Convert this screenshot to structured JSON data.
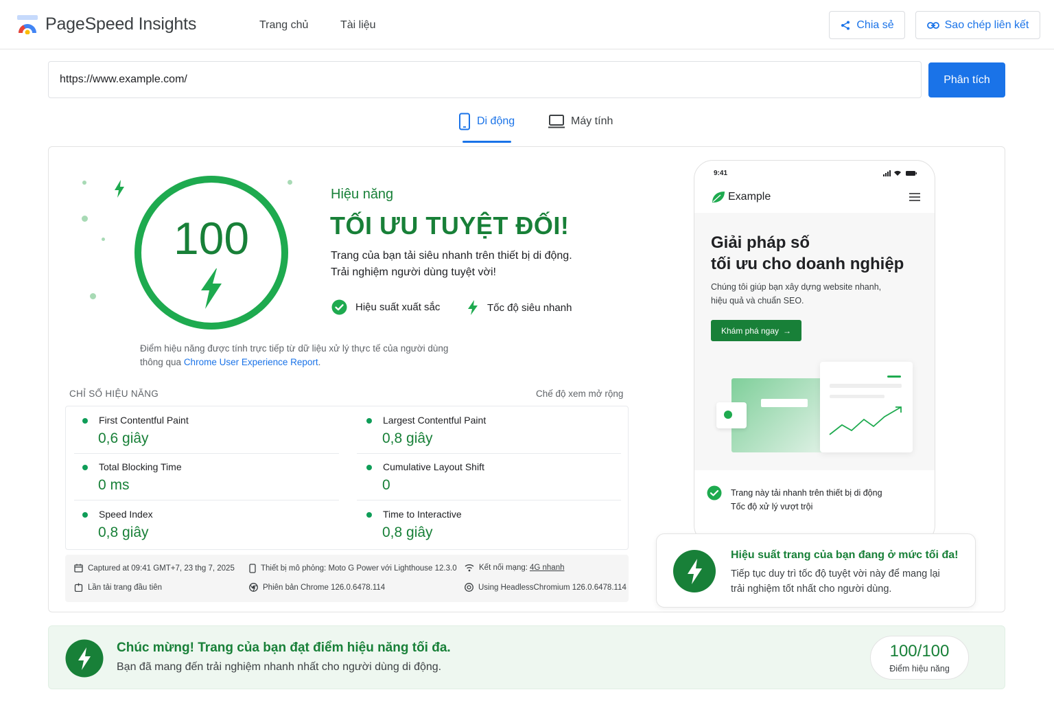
{
  "header": {
    "app_name": "PageSpeed Insights",
    "nav": [
      "Trang chủ",
      "Tài liệu"
    ],
    "share_label": "Chia sẻ",
    "copy_link_label": "Sao chép liên kết"
  },
  "search": {
    "url_value": "https://www.example.com/",
    "analyze_label": "Phân tích"
  },
  "tabs": [
    {
      "label": "Di động",
      "active": true
    },
    {
      "label": "Máy tính",
      "active": false
    }
  ],
  "score": {
    "value": "100",
    "color": "#1eaa4f"
  },
  "performance": {
    "category": "Hiệu năng",
    "headline": "TỐI ƯU TUYỆT ĐỐI!",
    "desc_line1": "Trang của bạn tải siêu nhanh trên thiết bị di động.",
    "desc_line2": "Trải nghiệm người dùng tuyệt vời!",
    "feature1": "Hiệu suất xuất sắc",
    "feature2": "Tốc độ siêu nhanh",
    "note_prefix": "Điểm hiệu năng được tính trực tiếp từ dữ liệu xử lý thực tế của người dùng thông qua ",
    "note_link": "Chrome User Experience Report",
    "note_suffix": "."
  },
  "metrics": {
    "header": "CHỈ SỐ HIỆU NĂNG",
    "expand_label": "Chế độ xem mở rộng",
    "items": [
      {
        "name": "First Contentful Paint",
        "value": "0,6 giây"
      },
      {
        "name": "Largest Contentful Paint",
        "value": "0,8 giây"
      },
      {
        "name": "Total Blocking Time",
        "value": "0 ms"
      },
      {
        "name": "Cumulative Layout Shift",
        "value": "0"
      },
      {
        "name": "Speed Index",
        "value": "0,8 giây"
      },
      {
        "name": "Time to Interactive",
        "value": "0,8 giây"
      }
    ]
  },
  "run_info": {
    "captured": "Captured at 09:41 GMT+7, 23 thg 7, 2025",
    "device": "Thiết bị mô phỏng: Moto G Power với Lighthouse 12.3.0",
    "network_prefix": "Kết nối mạng: ",
    "network_value": "4G nhanh",
    "first_load": "Lần tải trang đầu tiên",
    "chrome_version": "Phiên bản Chrome 126.0.6478.114",
    "headless": "Using HeadlessChromium 126.0.6478.114"
  },
  "preview": {
    "time": "9:41",
    "brand": "Example",
    "hero_line1": "Giải pháp số",
    "hero_line2": "tối ưu cho doanh nghiệp",
    "sub_line1": "Chúng tôi giúp bạn xây dựng website nhanh,",
    "sub_line2": "hiệu quả và chuẩn SEO.",
    "cta": "Khám phá ngay",
    "check_line1": "Trang này tải nhanh trên thiết bị di động",
    "check_line2": "Tốc độ xử lý vượt trội"
  },
  "result_card": {
    "title": "Hiệu suất trang của bạn đang ở mức tối đa!",
    "line1": "Tiếp tục duy trì tốc độ tuyệt vời này để mang lại",
    "line2": "trải nghiệm tốt nhất cho người dùng."
  },
  "banner": {
    "title": "Chúc mừng! Trang của bạn đạt điểm hiệu năng tối đa.",
    "subtitle": "Bạn đã mang đến trải nghiệm nhanh nhất cho người dùng di động.",
    "score": "100/100",
    "score_label": "Điểm hiệu năng"
  },
  "colors": {
    "accent": "#1a73e8",
    "good": "#188038",
    "good_bright": "#1eaa4f"
  }
}
